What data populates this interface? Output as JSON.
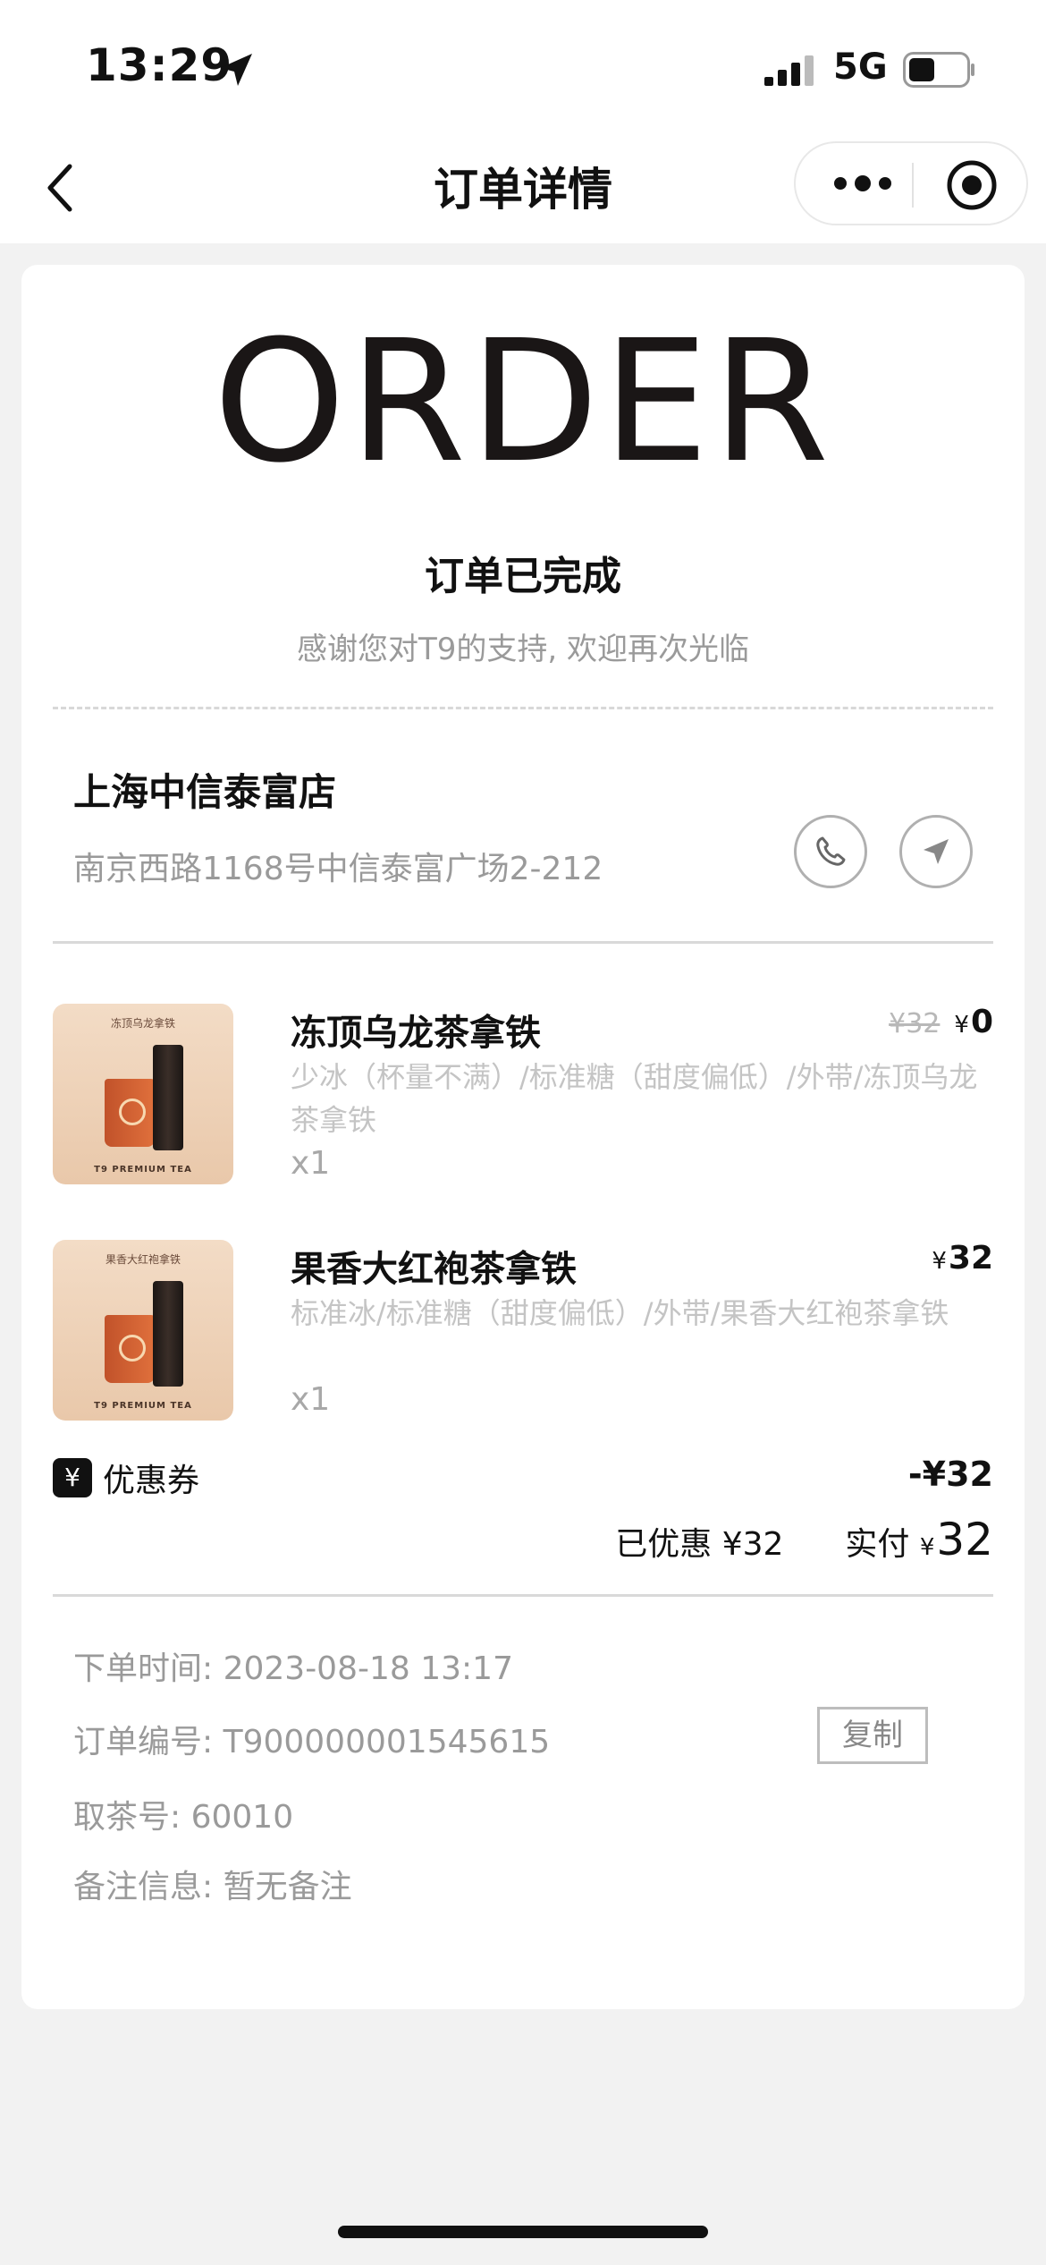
{
  "status_bar": {
    "time": "13:29",
    "network": "5G"
  },
  "nav": {
    "title": "订单详情"
  },
  "order": {
    "logo_text": "ORDER",
    "status": "订单已完成",
    "thanks": "感谢您对T9的支持, 欢迎再次光临"
  },
  "store": {
    "name": "上海中信泰富店",
    "address": "南京西路1168号中信泰富广场2-212"
  },
  "items": [
    {
      "name": "冻顶乌龙茶拿铁",
      "spec": "少冰（杯量不满）/标准糖（甜度偏低）/外带/冻顶乌龙茶拿铁",
      "qty": "x1",
      "original_price": "¥32",
      "currency": "¥",
      "price": "0",
      "image_tag": "冻顶乌龙拿铁",
      "image_brand": "T9 PREMIUM TEA"
    },
    {
      "name": "果香大红袍茶拿铁",
      "spec": "标准冰/标准糖（甜度偏低）/外带/果香大红袍茶拿铁",
      "qty": "x1",
      "currency": "¥",
      "price": "32",
      "image_tag": "果香大红袍拿铁",
      "image_brand": "T9 PREMIUM TEA"
    }
  ],
  "coupon": {
    "label": "优惠券",
    "icon": "¥",
    "amount": "-¥32"
  },
  "summary": {
    "discount_label": "已优惠",
    "discount_value": "¥32",
    "paid_label": "实付",
    "paid_currency": "¥",
    "paid_value": "32"
  },
  "info": {
    "order_time": "下单时间:  2023-08-18 13:17",
    "order_no": "订单编号:  T900000001545615",
    "pickup_no": "取茶号:  60010",
    "remark": "备注信息:  暂无备注",
    "copy_label": "复制"
  },
  "colors": {
    "accent": "#111111",
    "muted": "#9a9a9a",
    "background": "#f2f2f2"
  }
}
